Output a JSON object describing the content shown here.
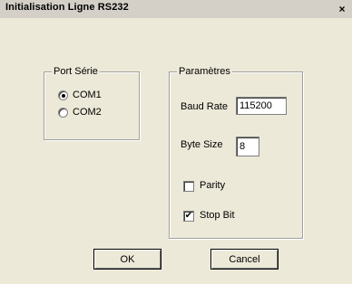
{
  "window": {
    "title": "Initialisation Ligne RS232",
    "close_glyph": "×",
    "close_icon": "close-icon"
  },
  "port_group": {
    "legend": "Port Série",
    "options": [
      {
        "label": "COM1",
        "selected": true
      },
      {
        "label": "COM2",
        "selected": false
      }
    ]
  },
  "params_group": {
    "legend": "Paramètres",
    "baud_rate_label": "Baud Rate",
    "baud_rate_value": "115200",
    "byte_size_label": "Byte Size",
    "byte_size_value": "8",
    "parity_label": "Parity",
    "parity_checked": false,
    "stop_bit_label": "Stop Bit",
    "stop_bit_checked": true
  },
  "buttons": {
    "ok_label": "OK",
    "cancel_label": "Cancel"
  },
  "check_glyph": "✔"
}
